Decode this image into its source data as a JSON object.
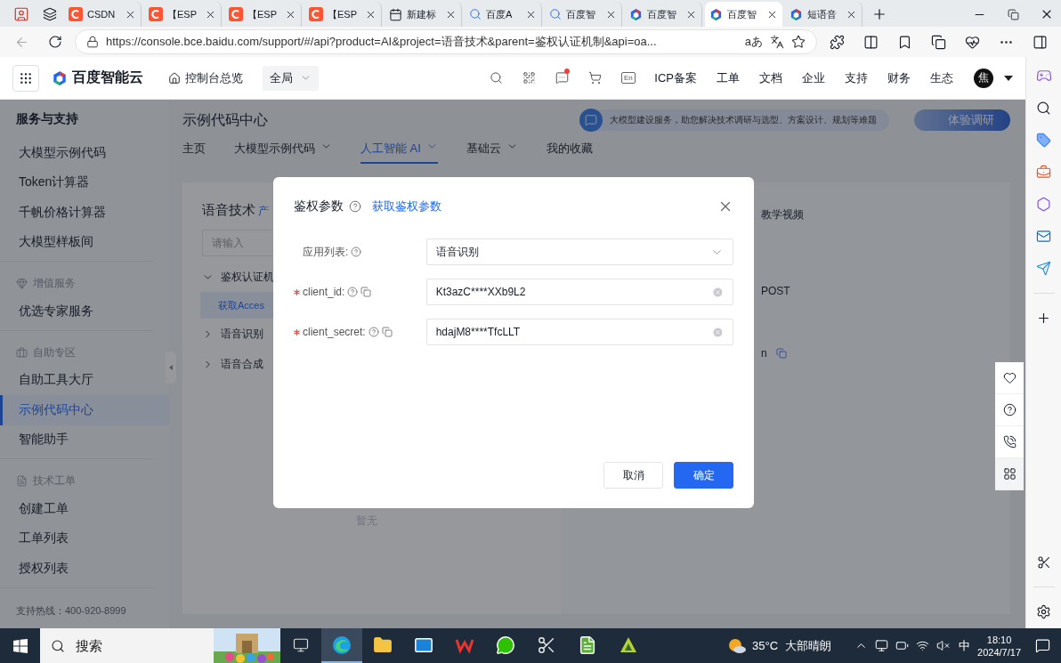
{
  "browser": {
    "tabs": [
      {
        "kind": "csdn",
        "label": "CSDN",
        "selected": false
      },
      {
        "kind": "csdn",
        "label": "【ESP",
        "selected": false
      },
      {
        "kind": "csdn",
        "label": "【ESP",
        "selected": false
      },
      {
        "kind": "csdn",
        "label": "【ESP",
        "selected": false
      },
      {
        "kind": "newtab",
        "label": "新建标",
        "selected": false
      },
      {
        "kind": "search",
        "label": "百度A",
        "selected": false
      },
      {
        "kind": "search",
        "label": "百度智",
        "selected": false
      },
      {
        "kind": "cloud",
        "label": "百度智",
        "selected": false
      },
      {
        "kind": "cloud",
        "label": "百度智",
        "selected": true
      },
      {
        "kind": "cloud",
        "label": "短语音",
        "selected": false
      }
    ],
    "url": "https://console.bce.baidu.com/support/#/api?product=AI&project=语音技术&parent=鉴权认证机制&api=oa...",
    "read_aloud": "aあ"
  },
  "header": {
    "logo": "百度智能云",
    "console": "控制台总览",
    "region": "全局",
    "messages_unread": true,
    "lang": "En",
    "links": [
      "ICP备案",
      "工单",
      "文档",
      "企业",
      "支持",
      "财务",
      "生态"
    ],
    "avatar": "焦"
  },
  "sidebar": {
    "title": "服务与支持",
    "sections": [
      {
        "items": [
          {
            "label": "大模型示例代码",
            "selected": false
          },
          {
            "label": "Token计算器",
            "selected": false
          },
          {
            "label": "千帆价格计算器",
            "selected": false
          },
          {
            "label": "大模型样板间",
            "selected": false
          }
        ]
      },
      {
        "kind": "value",
        "heading": "增值服务",
        "items": [
          {
            "label": "优选专家服务",
            "selected": false
          }
        ]
      },
      {
        "kind": "self",
        "heading": "自助专区",
        "items": [
          {
            "label": "自助工具大厅",
            "selected": false
          },
          {
            "label": "示例代码中心",
            "selected": true
          },
          {
            "label": "智能助手",
            "selected": false
          }
        ]
      },
      {
        "kind": "ticket",
        "heading": "技术工单",
        "items": [
          {
            "label": "创建工单",
            "selected": false
          },
          {
            "label": "工单列表",
            "selected": false
          },
          {
            "label": "授权列表",
            "selected": false
          }
        ]
      }
    ],
    "hotline": "支持热线：400-920-8999"
  },
  "page": {
    "title": "示例代码中心",
    "promo": "大模型建设服务，助您解决技术调研与选型、方案设计、规划等难题",
    "survey": "体验调研",
    "nav": [
      {
        "label": "主页",
        "dropdown": false,
        "selected": false
      },
      {
        "label": "大模型示例代码",
        "dropdown": true,
        "selected": false
      },
      {
        "label": "人工智能 AI",
        "dropdown": true,
        "selected": true
      },
      {
        "label": "基础云",
        "dropdown": true,
        "selected": false
      },
      {
        "label": "我的收藏",
        "dropdown": false,
        "selected": false
      }
    ]
  },
  "api_panel": {
    "title": "语音技术",
    "title_link": "产",
    "search": {
      "placeholder": "请输入"
    },
    "tree": [
      {
        "label": "鉴权认证机",
        "expanded": true,
        "children": [
          {
            "label": "获取Acces",
            "selected": true
          }
        ]
      },
      {
        "label": "语音识别",
        "expanded": false
      },
      {
        "label": "语音合成",
        "expanded": false
      }
    ],
    "middle_value": "暂无",
    "right_tab": "教学视频",
    "method": "POST",
    "token_tail": "n"
  },
  "dialog": {
    "title": "鉴权参数",
    "link": "获取鉴权参数",
    "fields": [
      {
        "kind": "select",
        "label": "应用列表:",
        "required": false,
        "value": "语音识别"
      },
      {
        "kind": "input",
        "label": "client_id:",
        "required": true,
        "value": "Kt3azC****XXb9L2"
      },
      {
        "kind": "input",
        "label": "client_secret:",
        "required": true,
        "value": "hdajM8****TfcLLT"
      }
    ],
    "buttons": [
      {
        "label": "取消",
        "primary": false
      },
      {
        "label": "确定",
        "primary": true
      }
    ]
  },
  "taskbar": {
    "search": {
      "placeholder": "搜索"
    },
    "apps": [
      {
        "kind": "edge",
        "selected": true
      },
      {
        "kind": "explorer",
        "selected": false
      },
      {
        "kind": "mail",
        "selected": false
      },
      {
        "kind": "wps",
        "selected": false
      },
      {
        "kind": "wechat",
        "selected": false
      },
      {
        "kind": "tool",
        "selected": false
      },
      {
        "kind": "notepad",
        "selected": false
      },
      {
        "kind": "green",
        "selected": false
      }
    ],
    "temperature": "35°C",
    "weather": "大部晴朗",
    "ime": "中",
    "time": "18:10",
    "date": "2024/7/17"
  }
}
